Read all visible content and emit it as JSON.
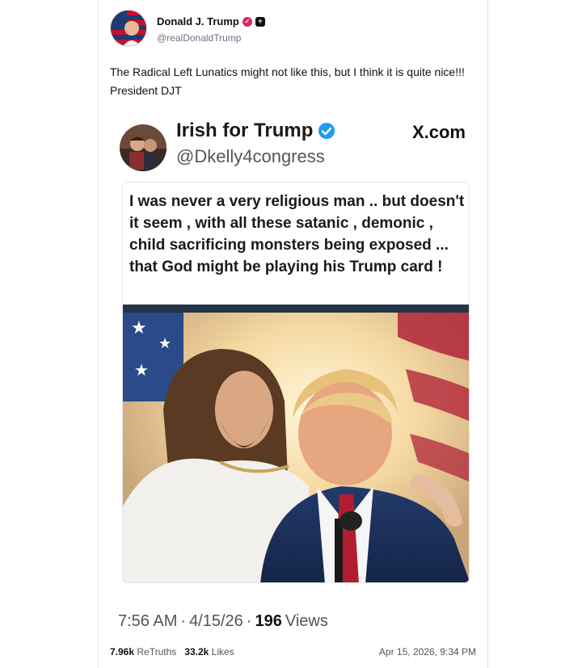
{
  "post": {
    "author_name": "Donald J. Trump",
    "author_handle": "@realDonaldTrump",
    "text": "The Radical Left Lunatics might not like this, but I think it is quite nice!!! President DJT"
  },
  "embed": {
    "author_name": "Irish for Trump",
    "author_handle": "@Dkelly4congress",
    "site": "X.com",
    "quote": "I was never a very religious man .. but doesn't it seem , with all these satanic , demonic , child sacrificing monsters being exposed ... that God might be playing his Trump card !",
    "time": "7:56 AM",
    "sep1": "·",
    "date": "4/15/26",
    "sep2": "·",
    "views_count": "196",
    "views_label": "Views"
  },
  "footer": {
    "retruths_count": "7.96k",
    "retruths_label": "ReTruths",
    "likes_count": "33.2k",
    "likes_label": "Likes",
    "timestamp": "Apr 15, 2026, 9:34 PM"
  },
  "icons": {
    "verified_red": "verified-badge-icon",
    "plus_badge": "plus-badge-icon",
    "verified_blue": "blue-check-icon"
  },
  "colors": {
    "accent_red": "#e0245e",
    "verified_blue": "#1d9bf0"
  }
}
